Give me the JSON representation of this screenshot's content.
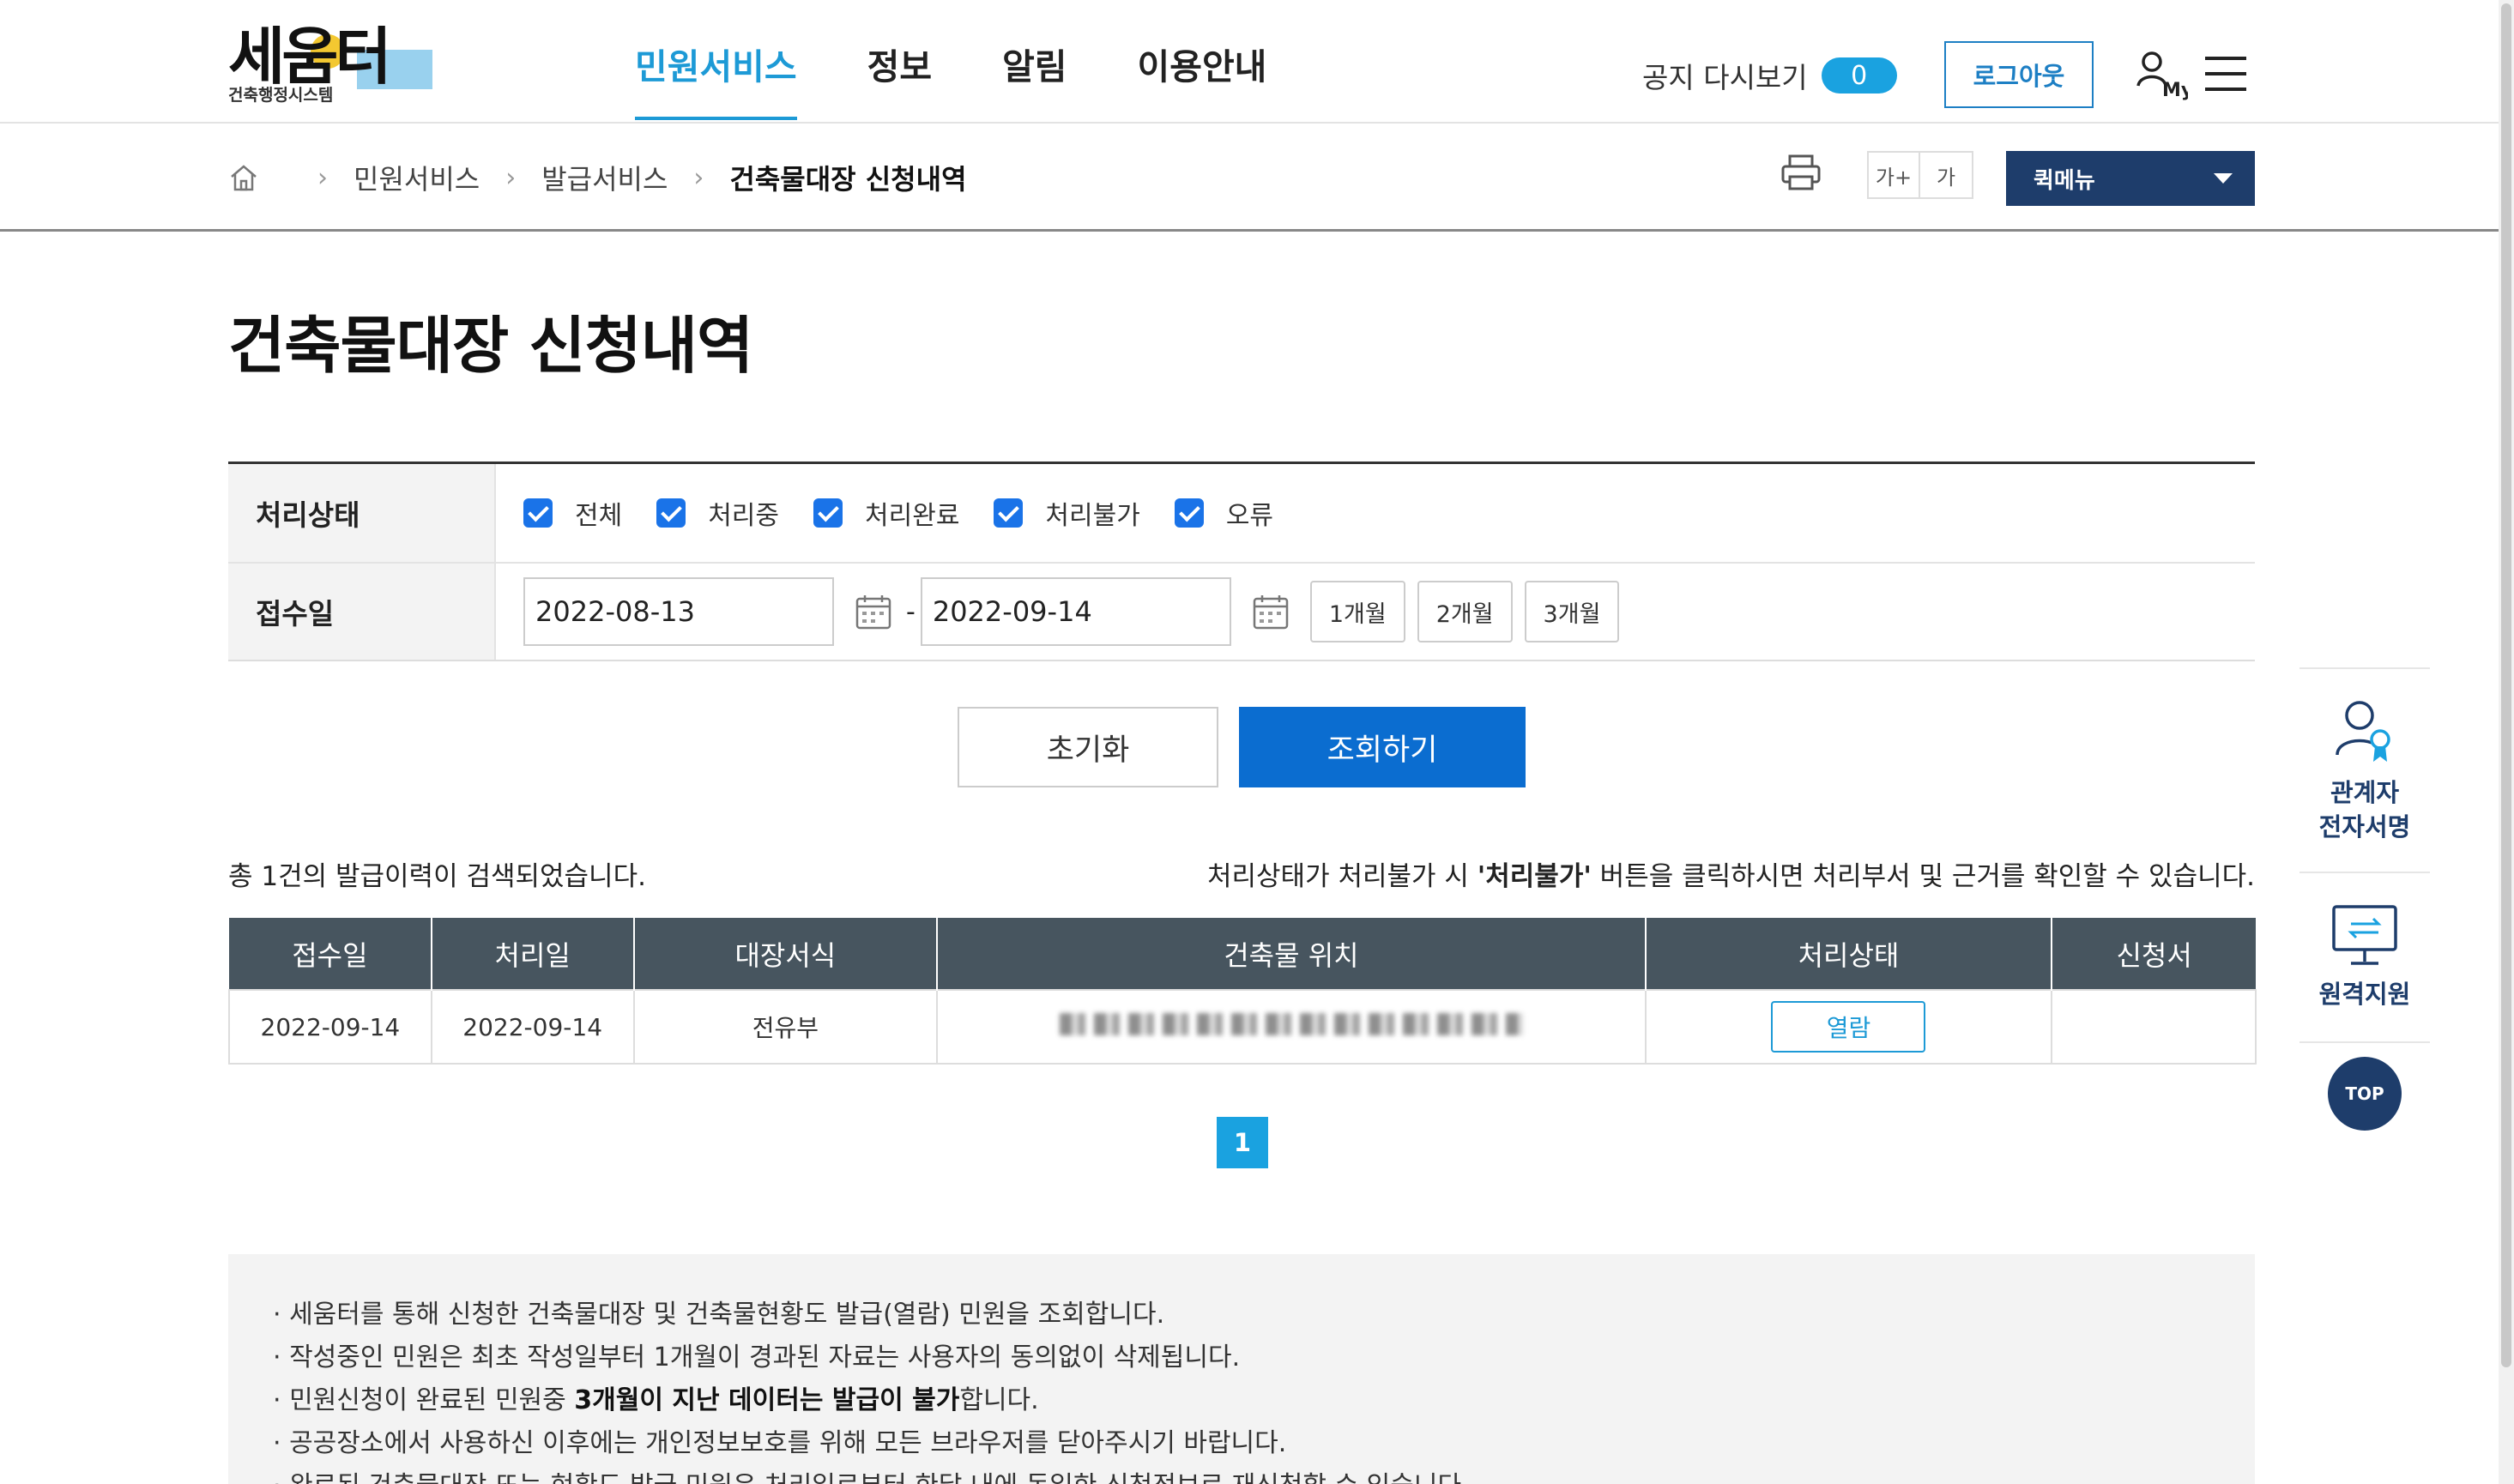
{
  "header": {
    "logo_text": "세움터",
    "logo_sub": "건축행정시스템",
    "nav": [
      "민원서비스",
      "정보",
      "알림",
      "이용안내"
    ],
    "notice_label": "공지 다시보기",
    "notice_count": "0",
    "logout_label": "로그아웃",
    "my_label": "My"
  },
  "location": {
    "crumbs": [
      "민원서비스",
      "발급서비스",
      "건축물대장 신청내역"
    ],
    "font_up": "가+",
    "font_down": "가",
    "quick_menu": "퀵메뉴"
  },
  "page_title": "건축물대장 신청내역",
  "search": {
    "status_label": "처리상태",
    "status_options": [
      "전체",
      "처리중",
      "처리완료",
      "처리불가",
      "오류"
    ],
    "date_label": "접수일",
    "date_from": "2022-08-13",
    "date_to": "2022-09-14",
    "date_sep": "-",
    "periods": [
      "1개월",
      "2개월",
      "3개월"
    ],
    "reset_label": "초기화",
    "search_label": "조회하기"
  },
  "result": {
    "count_text": "총 1건의 발급이력이 검색되었습니다.",
    "note_prefix": "처리상태가 처리불가 시 ",
    "note_bold": "'처리불가'",
    "note_suffix": " 버튼을 클릭하시면 처리부서 및 근거를 확인할 수 있습니다."
  },
  "table": {
    "headers": [
      "접수일",
      "처리일",
      "대장서식",
      "건축물 위치",
      "처리상태",
      "신청서"
    ],
    "rows": [
      {
        "received": "2022-09-14",
        "processed": "2022-09-14",
        "form": "전유부",
        "status_btn": "열람"
      }
    ]
  },
  "pagination": {
    "current": "1"
  },
  "guide": {
    "line1": "· 세움터를 통해 신청한 건축물대장 및 건축물현황도 발급(열람) 민원을 조회합니다.",
    "line2": "· 작성중인 민원은 최초 작성일부터 1개월이 경과된 자료는 사용자의 동의없이 삭제됩니다.",
    "line3_prefix": "·  민원신청이 완료된 민원중 ",
    "line3_bold": "3개월이 지난 데이터는 발급이 불가",
    "line3_suffix": "합니다.",
    "line4": "· 공공장소에서 사용하신 이후에는 개인정보보호를 위해 모든 브라우저를 닫아주시기 바랍니다.",
    "line5": "· 완료된 건축물대장 또는 현황도 발급 민원은 처리일로부터 한달 내에 동일한 신청정보로 재신청할 수 있습니다."
  },
  "side": {
    "signature_line1": "관계자",
    "signature_line2": "전자서명",
    "remote_label": "원격지원",
    "top_label": "TOP"
  },
  "colors": {
    "accent": "#1d9ad6",
    "primary_button": "#0b6dd0",
    "navy": "#1e3d6b",
    "table_header": "#47555f"
  }
}
